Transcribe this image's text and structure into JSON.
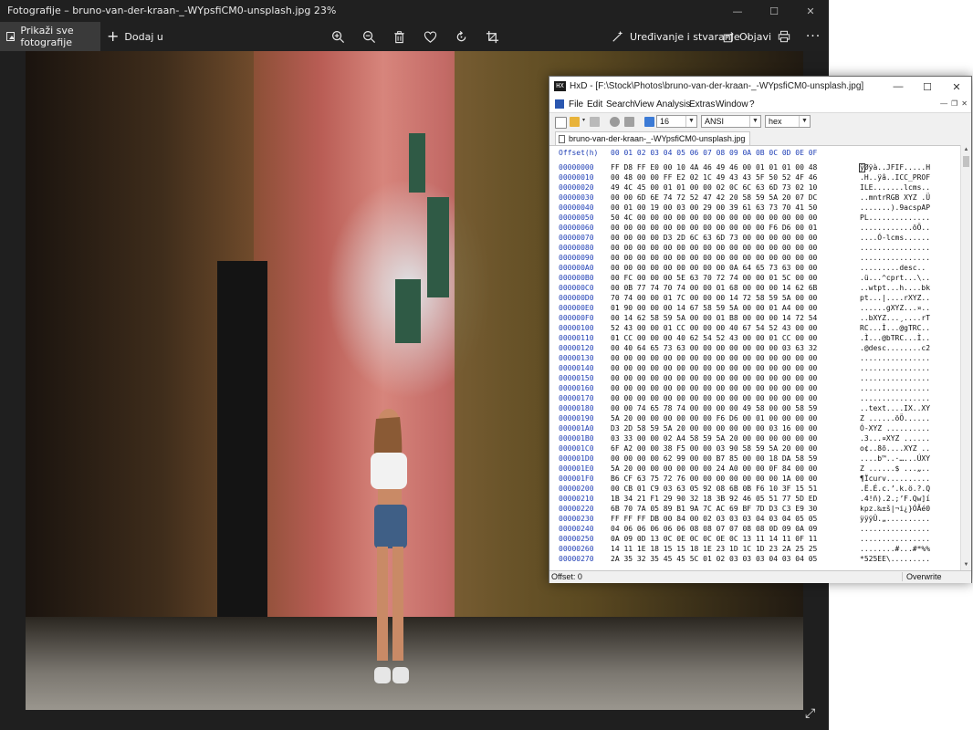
{
  "photos": {
    "title": "Fotografije – bruno-van-der-kraan-_-WYpsfiCM0-unsplash.jpg   23%",
    "view_all_label": "Prikaži sve fotografije",
    "add_label": "Dodaj u",
    "edit_label": "Uređivanje i stvaranje",
    "share_label": "Objavi",
    "more_label": "···"
  },
  "hxd": {
    "title": "HxD - [F:\\Stock\\Photos\\bruno-van-der-kraan-_-WYpsfiCM0-unsplash.jpg]",
    "menu": [
      "File",
      "Edit",
      "Search",
      "View",
      "Analysis",
      "Extras",
      "Window",
      "?"
    ],
    "bytes_per_row": "16",
    "charset": "ANSI",
    "display_mode": "hex",
    "tab_label": "bruno-van-der-kraan-_-WYpsfiCM0-unsplash.jpg",
    "header_offset": "Offset(h)",
    "header_columns": "00 01 02 03 04 05 06 07 08 09 0A 0B 0C 0D 0E 0F",
    "rows": [
      {
        "o": "00000000",
        "h": "FF D8 FF E0 00 10 4A 46 49 46 00 01 01 01 00 48",
        "t": "ÿØÿà..JFIF.....H"
      },
      {
        "o": "00000010",
        "h": "00 48 00 00 FF E2 02 1C 49 43 43 5F 50 52 4F 46",
        "t": ".H..ÿâ..ICC_PROF"
      },
      {
        "o": "00000020",
        "h": "49 4C 45 00 01 01 00 00 02 0C 6C 63 6D 73 02 10",
        "t": "ILE.......lcms.."
      },
      {
        "o": "00000030",
        "h": "00 00 6D 6E 74 72 52 47 42 20 58 59 5A 20 07 DC",
        "t": "..mntrRGB XYZ .Ü"
      },
      {
        "o": "00000040",
        "h": "00 01 00 19 00 03 00 29 00 39 61 63 73 70 41 50",
        "t": ".......).9acspAP"
      },
      {
        "o": "00000050",
        "h": "50 4C 00 00 00 00 00 00 00 00 00 00 00 00 00 00",
        "t": "PL.............."
      },
      {
        "o": "00000060",
        "h": "00 00 00 00 00 00 00 00 00 00 00 00 F6 D6 00 01",
        "t": "............öÖ.."
      },
      {
        "o": "00000070",
        "h": "00 00 00 00 D3 2D 6C 63 6D 73 00 00 00 00 00 00",
        "t": "....Ó-lcms......"
      },
      {
        "o": "00000080",
        "h": "00 00 00 00 00 00 00 00 00 00 00 00 00 00 00 00",
        "t": "................"
      },
      {
        "o": "00000090",
        "h": "00 00 00 00 00 00 00 00 00 00 00 00 00 00 00 00",
        "t": "................"
      },
      {
        "o": "000000A0",
        "h": "00 00 00 00 00 00 00 00 00 0A 64 65 73 63 00 00",
        "t": ".........desc.."
      },
      {
        "o": "000000B0",
        "h": "00 FC 00 00 00 5E 63 70 72 74 00 00 01 5C 00 00",
        "t": ".ü...^cprt...\\.."
      },
      {
        "o": "000000C0",
        "h": "00 0B 77 74 70 74 00 00 01 68 00 00 00 14 62 6B",
        "t": "..wtpt...h....bk"
      },
      {
        "o": "000000D0",
        "h": "70 74 00 00 01 7C 00 00 00 14 72 58 59 5A 00 00",
        "t": "pt...|....rXYZ.."
      },
      {
        "o": "000000E0",
        "h": "01 90 00 00 00 14 67 58 59 5A 00 00 01 A4 00 00",
        "t": "......gXYZ...¤.."
      },
      {
        "o": "000000F0",
        "h": "00 14 62 58 59 5A 00 00 01 B8 00 00 00 14 72 54",
        "t": "..bXYZ...¸....rT"
      },
      {
        "o": "00000100",
        "h": "52 43 00 00 01 CC 00 00 00 40 67 54 52 43 00 00",
        "t": "RC...Ì...@gTRC.."
      },
      {
        "o": "00000110",
        "h": "01 CC 00 00 00 40 62 54 52 43 00 00 01 CC 00 00",
        "t": ".Ì...@bTRC...Ì.."
      },
      {
        "o": "00000120",
        "h": "00 40 64 65 73 63 00 00 00 00 00 00 00 03 63 32",
        "t": ".@desc........c2"
      },
      {
        "o": "00000130",
        "h": "00 00 00 00 00 00 00 00 00 00 00 00 00 00 00 00",
        "t": "................"
      },
      {
        "o": "00000140",
        "h": "00 00 00 00 00 00 00 00 00 00 00 00 00 00 00 00",
        "t": "................"
      },
      {
        "o": "00000150",
        "h": "00 00 00 00 00 00 00 00 00 00 00 00 00 00 00 00",
        "t": "................"
      },
      {
        "o": "00000160",
        "h": "00 00 00 00 00 00 00 00 00 00 00 00 00 00 00 00",
        "t": "................"
      },
      {
        "o": "00000170",
        "h": "00 00 00 00 00 00 00 00 00 00 00 00 00 00 00 00",
        "t": "................"
      },
      {
        "o": "00000180",
        "h": "00 00 74 65 78 74 00 00 00 00 49 58 00 00 58 59",
        "t": "..text....IX..XY"
      },
      {
        "o": "00000190",
        "h": "5A 20 00 00 00 00 00 00 F6 D6 00 01 00 00 00 00",
        "t": "Z ......öÖ......"
      },
      {
        "o": "000001A0",
        "h": "D3 2D 58 59 5A 20 00 00 00 00 00 00 03 16 00 00",
        "t": "Ó-XYZ .........."
      },
      {
        "o": "000001B0",
        "h": "03 33 00 00 02 A4 58 59 5A 20 00 00 00 00 00 00",
        "t": ".3...¤XYZ ......"
      },
      {
        "o": "000001C0",
        "h": "6F A2 00 00 38 F5 00 00 03 90 58 59 5A 20 00 00",
        "t": "o¢..8õ....XYZ .."
      },
      {
        "o": "000001D0",
        "h": "00 00 00 00 62 99 00 00 B7 85 00 00 18 DA 58 59",
        "t": "....b™..·…...ÚXY"
      },
      {
        "o": "000001E0",
        "h": "5A 20 00 00 00 00 00 00 24 A0 00 00 0F 84 00 00",
        "t": "Z ......$ ...„.."
      },
      {
        "o": "000001F0",
        "h": "B6 CF 63 75 72 76 00 00 00 00 00 00 00 1A 00 00",
        "t": "¶Ïcurv.........."
      },
      {
        "o": "00000200",
        "h": "00 CB 01 C9 03 63 05 92 08 6B 0B F6 10 3F 15 51",
        "t": ".Ë.É.c.’.k.ö.?.Q"
      },
      {
        "o": "00000210",
        "h": "1B 34 21 F1 29 90 32 18 3B 92 46 05 51 77 5D ED",
        "t": ".4!ñ).2.;’F.Qw]í"
      },
      {
        "o": "00000220",
        "h": "6B 70 7A 05 89 B1 9A 7C AC 69 BF 7D D3 C3 E9 30",
        "t": "kpz.‰±š|¬i¿}ÓÃé0"
      },
      {
        "o": "00000230",
        "h": "FF FF FF DB 00 84 00 02 03 03 03 04 03 04 05 05",
        "t": "ÿÿÿÛ.„.........."
      },
      {
        "o": "00000240",
        "h": "04 06 06 06 06 06 08 08 07 07 08 08 0D 09 0A 09",
        "t": "................"
      },
      {
        "o": "00000250",
        "h": "0A 09 0D 13 0C 0E 0C 0C 0E 0C 13 11 14 11 0F 11",
        "t": "................"
      },
      {
        "o": "00000260",
        "h": "14 11 1E 18 15 15 18 1E 23 1D 1C 1D 23 2A 25 25",
        "t": "........#...#*%%"
      },
      {
        "o": "00000270",
        "h": "2A 35 32 35 45 45 5C 01 02 03 03 03 04 03 04 05",
        "t": "*525EE\\........."
      }
    ],
    "status_offset": "Offset: 0",
    "status_mode": "Overwrite"
  }
}
